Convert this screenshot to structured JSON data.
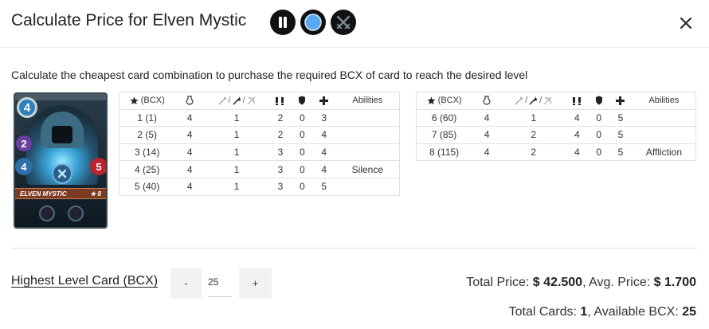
{
  "header": {
    "title": "Calculate Price for Elven Mystic",
    "badges": [
      "pause-badge-icon",
      "water-element-icon",
      "crossed-swords-icon"
    ]
  },
  "description": "Calculate the cheapest card combination to purchase the required BCX of card to reach the desired level",
  "card": {
    "name": "ELVEN MYSTIC",
    "level_badge": "★ 8",
    "mana": "4",
    "speed": "2",
    "armor": "4",
    "health": "5"
  },
  "table_headers": {
    "bcx": "(BCX)",
    "abilities": "Abilities",
    "sep": "/"
  },
  "table_left": [
    {
      "bcx": "1 (1)",
      "mana": "4",
      "attack": "1",
      "speed": "2",
      "armor": "0",
      "health": "3",
      "ability": ""
    },
    {
      "bcx": "2 (5)",
      "mana": "4",
      "attack": "1",
      "speed": "2",
      "armor": "0",
      "health": "4",
      "ability": ""
    },
    {
      "bcx": "3 (14)",
      "mana": "4",
      "attack": "1",
      "speed": "3",
      "armor": "0",
      "health": "4",
      "ability": ""
    },
    {
      "bcx": "4 (25)",
      "mana": "4",
      "attack": "1",
      "speed": "3",
      "armor": "0",
      "health": "4",
      "ability": "Silence"
    },
    {
      "bcx": "5 (40)",
      "mana": "4",
      "attack": "1",
      "speed": "3",
      "armor": "0",
      "health": "5",
      "ability": ""
    }
  ],
  "table_right": [
    {
      "bcx": "6 (60)",
      "mana": "4",
      "attack": "1",
      "speed": "4",
      "armor": "0",
      "health": "5",
      "ability": ""
    },
    {
      "bcx": "7 (85)",
      "mana": "4",
      "attack": "2",
      "speed": "4",
      "armor": "0",
      "health": "5",
      "ability": ""
    },
    {
      "bcx": "8 (115)",
      "mana": "4",
      "attack": "2",
      "speed": "4",
      "armor": "0",
      "health": "5",
      "ability": "Affliction"
    }
  ],
  "footer": {
    "highest_level_label": "Highest Level Card (BCX)",
    "minus_label": "-",
    "plus_label": "+",
    "quantity": "25",
    "total_price_label": "Total Price: ",
    "total_price": "$ 42.500",
    "avg_price_label": ", Avg. Price: ",
    "avg_price": "$ 1.700",
    "total_cards_label": "Total Cards: ",
    "total_cards": "1",
    "available_bcx_label": ", Available BCX: ",
    "available_bcx": "25"
  },
  "colors": {
    "divider": "#e0e0e0",
    "water": "#5aa9f0",
    "health": "#b9252a",
    "speed": "#6b3fa0"
  }
}
